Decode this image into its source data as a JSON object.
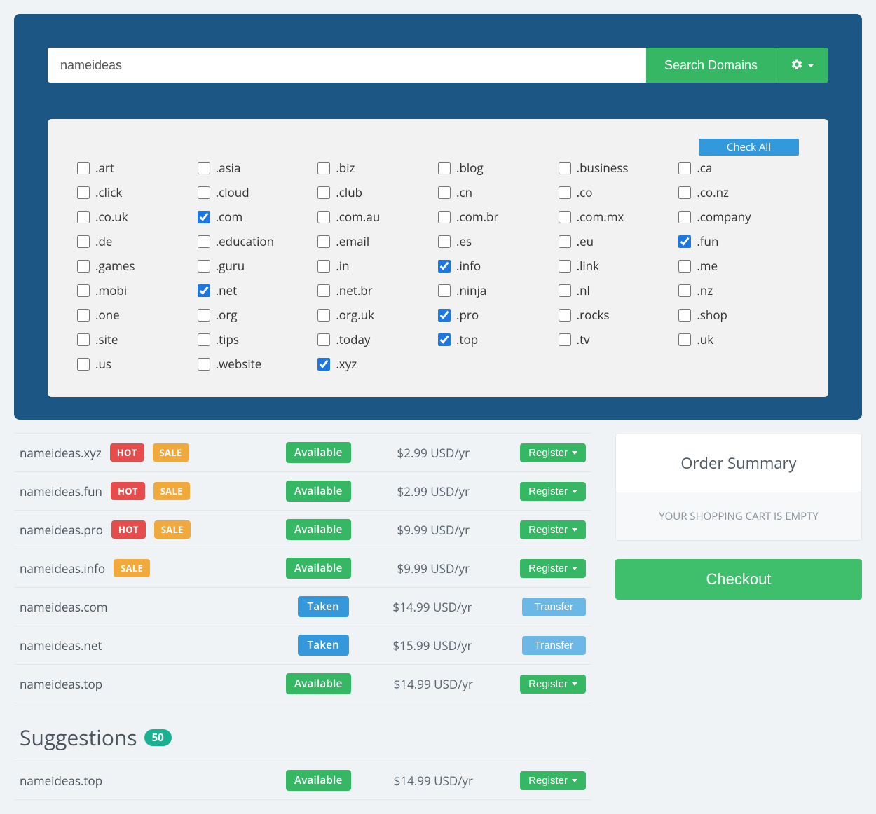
{
  "search": {
    "value": "nameideas",
    "button": "Search Domains"
  },
  "checkAll": "Check All",
  "tlds": [
    {
      "label": ".art",
      "checked": false
    },
    {
      "label": ".asia",
      "checked": false
    },
    {
      "label": ".biz",
      "checked": false
    },
    {
      "label": ".blog",
      "checked": false
    },
    {
      "label": ".business",
      "checked": false
    },
    {
      "label": ".ca",
      "checked": false
    },
    {
      "label": ".click",
      "checked": false
    },
    {
      "label": ".cloud",
      "checked": false
    },
    {
      "label": ".club",
      "checked": false
    },
    {
      "label": ".cn",
      "checked": false
    },
    {
      "label": ".co",
      "checked": false
    },
    {
      "label": ".co.nz",
      "checked": false
    },
    {
      "label": ".co.uk",
      "checked": false
    },
    {
      "label": ".com",
      "checked": true
    },
    {
      "label": ".com.au",
      "checked": false
    },
    {
      "label": ".com.br",
      "checked": false
    },
    {
      "label": ".com.mx",
      "checked": false
    },
    {
      "label": ".company",
      "checked": false
    },
    {
      "label": ".de",
      "checked": false
    },
    {
      "label": ".education",
      "checked": false
    },
    {
      "label": ".email",
      "checked": false
    },
    {
      "label": ".es",
      "checked": false
    },
    {
      "label": ".eu",
      "checked": false
    },
    {
      "label": ".fun",
      "checked": true
    },
    {
      "label": ".games",
      "checked": false
    },
    {
      "label": ".guru",
      "checked": false
    },
    {
      "label": ".in",
      "checked": false
    },
    {
      "label": ".info",
      "checked": true
    },
    {
      "label": ".link",
      "checked": false
    },
    {
      "label": ".me",
      "checked": false
    },
    {
      "label": ".mobi",
      "checked": false
    },
    {
      "label": ".net",
      "checked": true
    },
    {
      "label": ".net.br",
      "checked": false
    },
    {
      "label": ".ninja",
      "checked": false
    },
    {
      "label": ".nl",
      "checked": false
    },
    {
      "label": ".nz",
      "checked": false
    },
    {
      "label": ".one",
      "checked": false
    },
    {
      "label": ".org",
      "checked": false
    },
    {
      "label": ".org.uk",
      "checked": false
    },
    {
      "label": ".pro",
      "checked": true
    },
    {
      "label": ".rocks",
      "checked": false
    },
    {
      "label": ".shop",
      "checked": false
    },
    {
      "label": ".site",
      "checked": false
    },
    {
      "label": ".tips",
      "checked": false
    },
    {
      "label": ".today",
      "checked": false
    },
    {
      "label": ".top",
      "checked": true
    },
    {
      "label": ".tv",
      "checked": false
    },
    {
      "label": ".uk",
      "checked": false
    },
    {
      "label": ".us",
      "checked": false
    },
    {
      "label": ".website",
      "checked": false
    },
    {
      "label": ".xyz",
      "checked": true
    }
  ],
  "badges": {
    "hot": "HOT",
    "sale": "SALE",
    "available": "Available",
    "taken": "Taken"
  },
  "actions": {
    "register": "Register",
    "transfer": "Transfer"
  },
  "results": [
    {
      "domain": "nameideas.xyz",
      "hot": true,
      "sale": true,
      "status": "available",
      "price": "$2.99 USD/yr",
      "action": "register"
    },
    {
      "domain": "nameideas.fun",
      "hot": true,
      "sale": true,
      "status": "available",
      "price": "$2.99 USD/yr",
      "action": "register"
    },
    {
      "domain": "nameideas.pro",
      "hot": true,
      "sale": true,
      "status": "available",
      "price": "$9.99 USD/yr",
      "action": "register"
    },
    {
      "domain": "nameideas.info",
      "hot": false,
      "sale": true,
      "status": "available",
      "price": "$9.99 USD/yr",
      "action": "register"
    },
    {
      "domain": "nameideas.com",
      "hot": false,
      "sale": false,
      "status": "taken",
      "price": "$14.99 USD/yr",
      "action": "transfer"
    },
    {
      "domain": "nameideas.net",
      "hot": false,
      "sale": false,
      "status": "taken",
      "price": "$15.99 USD/yr",
      "action": "transfer"
    },
    {
      "domain": "nameideas.top",
      "hot": false,
      "sale": false,
      "status": "available",
      "price": "$14.99 USD/yr",
      "action": "register"
    }
  ],
  "order": {
    "title": "Order Summary",
    "empty": "YOUR SHOPPING CART IS EMPTY",
    "checkout": "Checkout"
  },
  "suggestions": {
    "title": "Suggestions",
    "count": "50",
    "items": [
      {
        "domain": "nameideas.top",
        "status": "available",
        "price": "$14.99 USD/yr",
        "action": "register"
      }
    ]
  }
}
